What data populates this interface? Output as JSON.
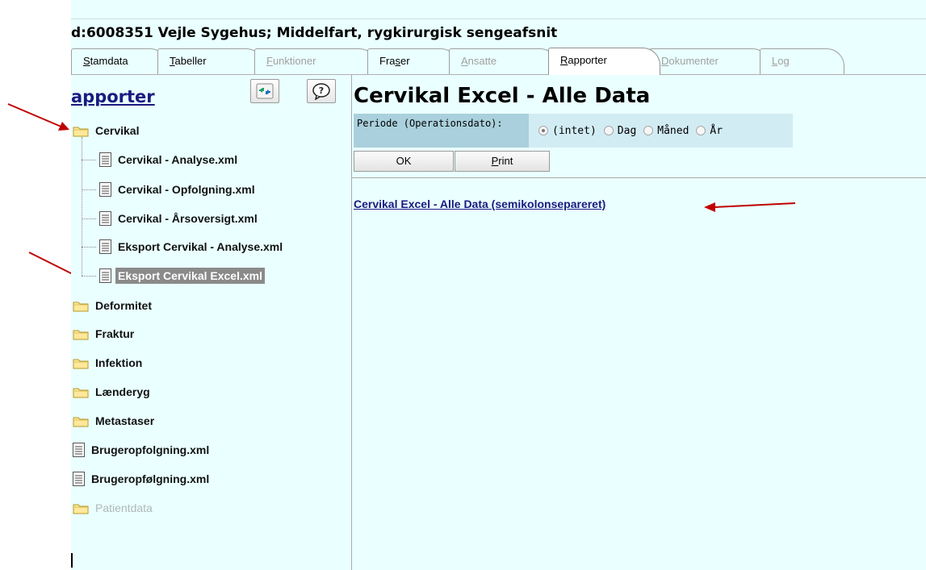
{
  "header": {
    "title": "d:6008351 Vejle Sygehus; Middelfart, rygkirurgisk sengeafsnit"
  },
  "tabs": [
    {
      "label": "Stamdata",
      "key": "S",
      "rest": "tamdata",
      "state": "normal"
    },
    {
      "label": "Tabeller",
      "key": "T",
      "rest": "abeller",
      "state": "normal"
    },
    {
      "label": "Funktioner",
      "key": "F",
      "rest": "unktioner",
      "state": "disabled"
    },
    {
      "label": "Fraser",
      "pre": "Fra",
      "key": "s",
      "rest": "er",
      "state": "normal"
    },
    {
      "label": "Ansatte",
      "key": "A",
      "rest": "nsatte",
      "state": "disabled"
    },
    {
      "label": "Rapporter",
      "key": "R",
      "rest": "apporter",
      "state": "active"
    },
    {
      "label": "Dokumenter",
      "key": "D",
      "rest": "okumenter",
      "state": "disabled"
    },
    {
      "label": "Log",
      "key": "L",
      "rest": "og",
      "state": "disabled"
    }
  ],
  "sidebar": {
    "title": "apporter",
    "refresh_icon": "refresh-arrows-icon",
    "help_icon": "help-question-icon",
    "tree": [
      {
        "label": "Cervikal",
        "type": "folder"
      },
      {
        "label": "Cervikal - Analyse.xml",
        "type": "doc"
      },
      {
        "label": "Cervikal - Opfolgning.xml",
        "type": "doc"
      },
      {
        "label": "Cervikal - Årsoversigt.xml",
        "type": "doc"
      },
      {
        "label": "Eksport Cervikal - Analyse.xml",
        "type": "doc"
      },
      {
        "label": "Eksport Cervikal Excel.xml",
        "type": "doc",
        "selected": true
      },
      {
        "label": "Deformitet",
        "type": "folder"
      },
      {
        "label": "Fraktur",
        "type": "folder"
      },
      {
        "label": "Infektion",
        "type": "folder"
      },
      {
        "label": "Lænderyg",
        "type": "folder"
      },
      {
        "label": "Metastaser",
        "type": "folder"
      },
      {
        "label": "Brugeropfolgning.xml",
        "type": "doc"
      },
      {
        "label": "Brugeropfølgning.xml",
        "type": "doc"
      },
      {
        "label": "Patientdata",
        "type": "folder",
        "disabled": true
      }
    ]
  },
  "main": {
    "title": "Cervikal Excel - Alle Data",
    "period_label": "Periode (Operationsdato):",
    "period_options": [
      {
        "label": "(intet)",
        "checked": true
      },
      {
        "label": "Dag",
        "checked": false
      },
      {
        "label": "Måned",
        "checked": false
      },
      {
        "label": "År",
        "checked": false
      }
    ],
    "ok_label": "OK",
    "print_label": "Print",
    "print_key": "P",
    "print_rest": "rint",
    "report_link": "Cervikal Excel - Alle Data (semikolonsepareret)"
  },
  "colors": {
    "background": "#eaffff",
    "link": "#1a1a80",
    "annotation_arrow": "#c00000",
    "period_label_bg": "#a9d0dc",
    "period_options_bg": "#d2ecf4",
    "selected_bg": "#8a8a8a"
  }
}
